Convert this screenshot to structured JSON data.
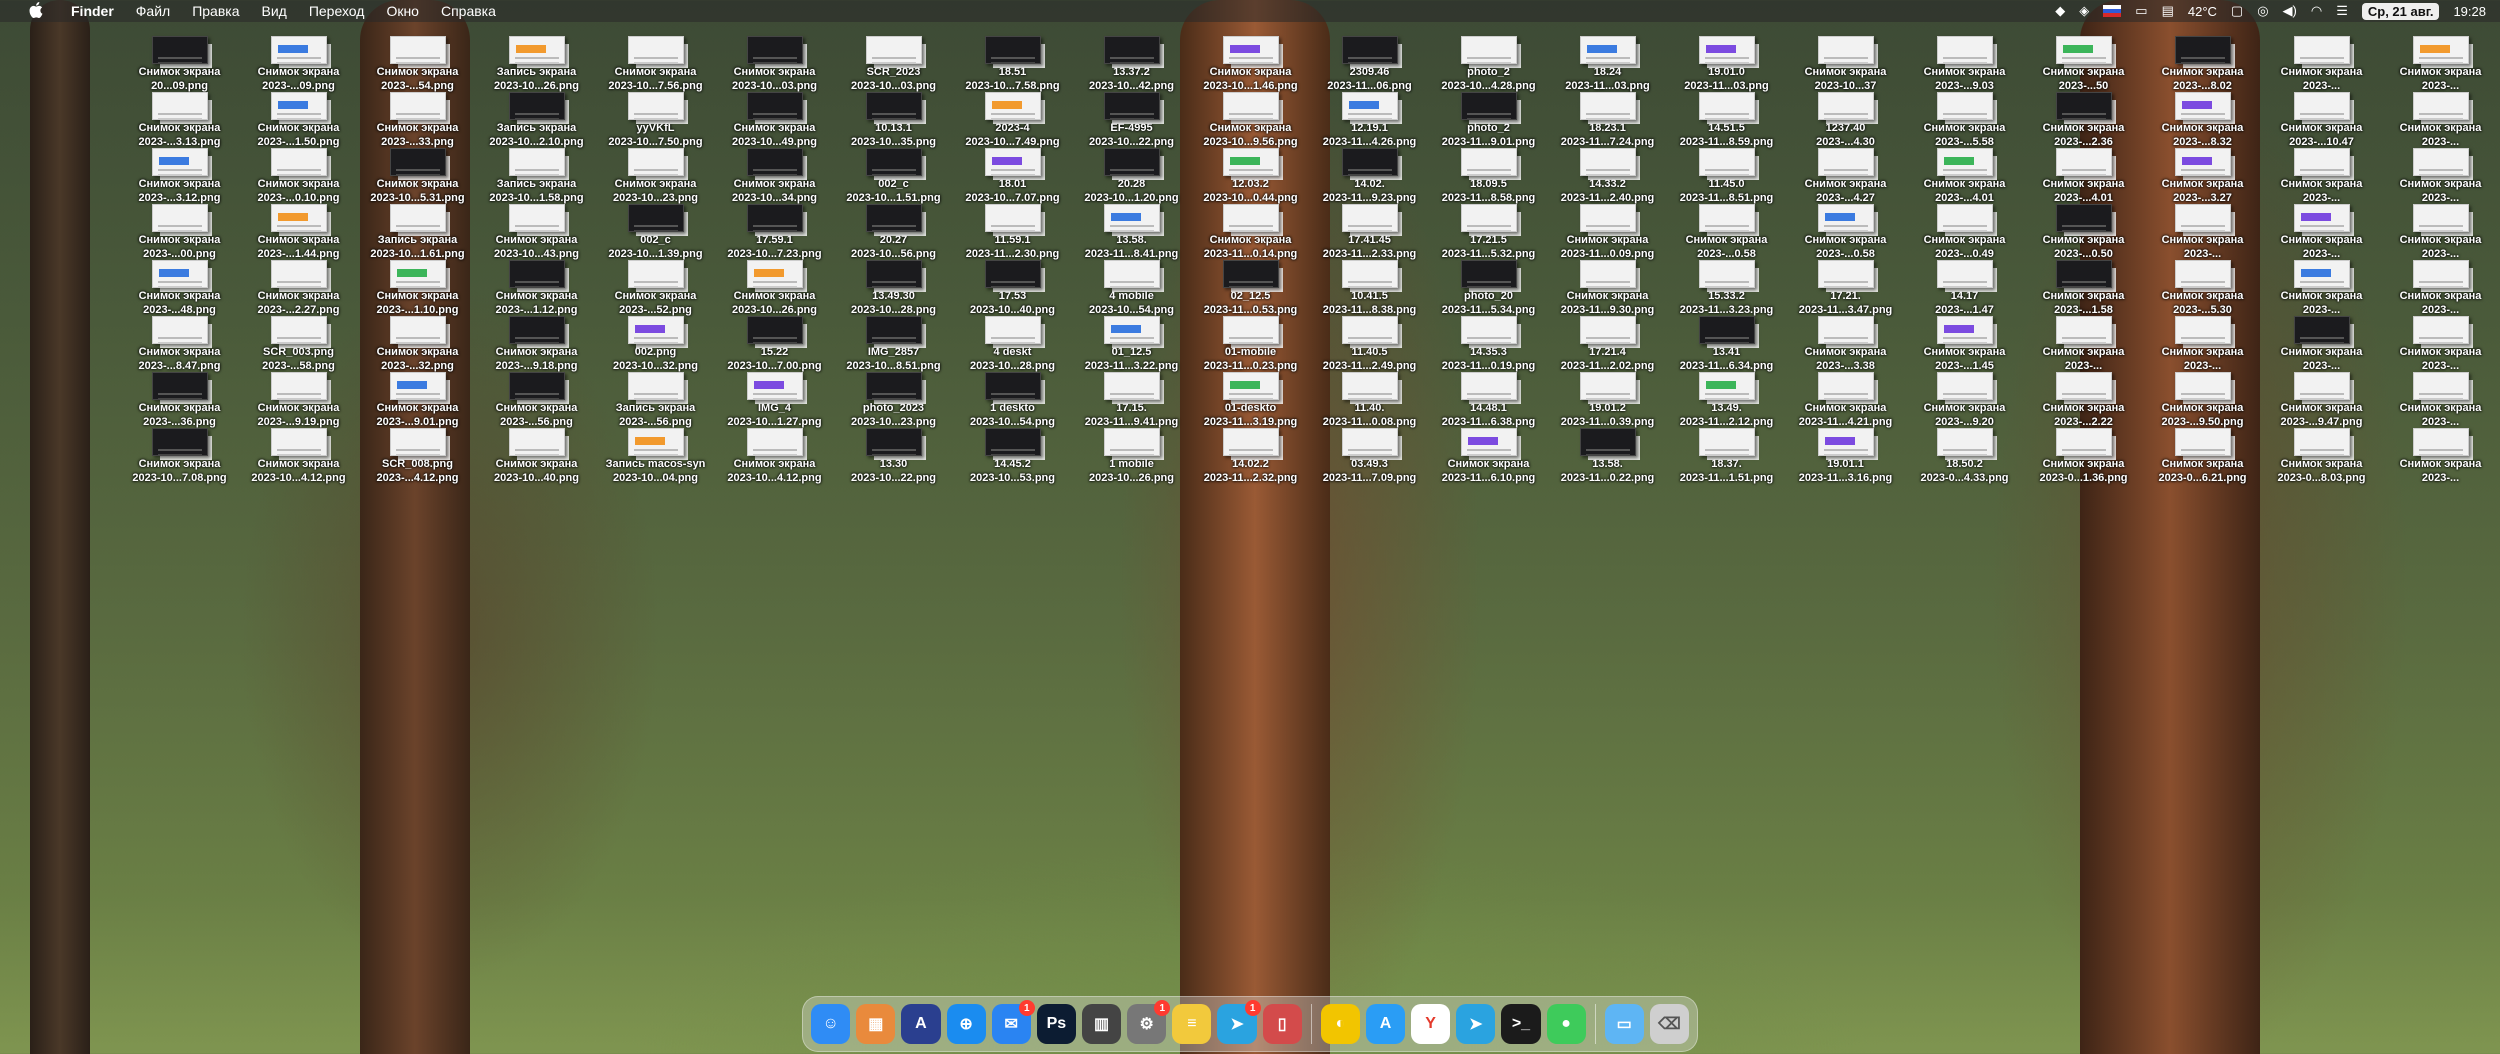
{
  "menubar": {
    "app_name": "Finder",
    "menus": [
      "Файл",
      "Правка",
      "Вид",
      "Переход",
      "Окно",
      "Справка"
    ],
    "temperature": "42°C",
    "date": "Ср, 21 авг.",
    "time": "19:28",
    "status_icons": [
      "dropbox-icon",
      "vpn-icon",
      "flag-ru-icon",
      "battery-icon",
      "temperature-icon",
      "message-icon",
      "screen-icon",
      "volume-icon",
      "wifi-icon"
    ]
  },
  "desktop": {
    "files": [
      {
        "name": "Снимок экрана",
        "sub": "20...09.png",
        "style": "dark"
      },
      {
        "name": "Снимок экрана",
        "sub": "2023-...09.png",
        "style": "blue"
      },
      {
        "name": "Снимок экрана",
        "sub": "2023-...54.png",
        "style": "light"
      },
      {
        "name": "Запись экрана",
        "sub": "2023-10...26.png",
        "style": "orange"
      },
      {
        "name": "Снимок экрана",
        "sub": "2023-10...7.56.png",
        "style": "light"
      },
      {
        "name": "Снимок экрана",
        "sub": "2023-10...03.png",
        "style": "dark"
      },
      {
        "name": "SCR_2023",
        "sub": "2023-10...03.png",
        "style": "light"
      },
      {
        "name": "18.51",
        "sub": "2023-10...7.58.png",
        "style": "dark"
      },
      {
        "name": "13.37.2",
        "sub": "2023-10...42.png",
        "style": "dark"
      },
      {
        "name": "Снимок экрана",
        "sub": "2023-10...1.46.png",
        "style": "purple"
      },
      {
        "name": "2309.46",
        "sub": "2023-11...06.png",
        "style": "dark"
      },
      {
        "name": "photo_2",
        "sub": "2023-10...4.28.png",
        "style": "light"
      },
      {
        "name": "18.24",
        "sub": "2023-11...03.png",
        "style": "blue"
      },
      {
        "name": "19.01.0",
        "sub": "2023-11...03.png",
        "style": "purple"
      },
      {
        "name": "Снимок экрана",
        "sub": "2023-10...37",
        "style": "light"
      },
      {
        "name": "Снимок экрана",
        "sub": "2023-...9.03",
        "style": "light"
      },
      {
        "name": "Снимок экрана",
        "sub": "2023-...50",
        "style": "green"
      },
      {
        "name": "Снимок экрана",
        "sub": "2023-...8.02",
        "style": "dark"
      },
      {
        "name": "Снимок экрана",
        "sub": "2023-...",
        "style": "light"
      },
      {
        "name": "Снимок экрана",
        "sub": "2023-...",
        "style": "orange"
      },
      {
        "name": "Снимок экрана",
        "sub": "2023-...3.13.png",
        "style": "light"
      },
      {
        "name": "Снимок экрана",
        "sub": "2023-...1.50.png",
        "style": "blue"
      },
      {
        "name": "Снимок экрана",
        "sub": "2023-...33.png",
        "style": "light"
      },
      {
        "name": "Запись экрана",
        "sub": "2023-10...2.10.png",
        "style": "dark"
      },
      {
        "name": "yyVKfL",
        "sub": "2023-10...7.50.png",
        "style": "light"
      },
      {
        "name": "Снимок экрана",
        "sub": "2023-10...49.png",
        "style": "dark"
      },
      {
        "name": "10.13.1",
        "sub": "2023-10...35.png",
        "style": "dark"
      },
      {
        "name": "2023-4",
        "sub": "2023-10...7.49.png",
        "style": "orange"
      },
      {
        "name": "EF-4995",
        "sub": "2023-10...22.png",
        "style": "dark"
      },
      {
        "name": "Снимок экрана",
        "sub": "2023-10...9.56.png",
        "style": "light"
      },
      {
        "name": "12.19.1",
        "sub": "2023-11...4.26.png",
        "style": "blue"
      },
      {
        "name": "photo_2",
        "sub": "2023-11...9.01.png",
        "style": "dark"
      },
      {
        "name": "18.23.1",
        "sub": "2023-11...7.24.png",
        "style": "light"
      },
      {
        "name": "14.51.5",
        "sub": "2023-11...8.59.png",
        "style": "light"
      },
      {
        "name": "1237.40",
        "sub": "2023-...4.30",
        "style": "light"
      },
      {
        "name": "Снимок экрана",
        "sub": "2023-...5.58",
        "style": "light"
      },
      {
        "name": "Снимок экрана",
        "sub": "2023-...2.36",
        "style": "dark"
      },
      {
        "name": "Снимок экрана",
        "sub": "2023-...8.32",
        "style": "purple"
      },
      {
        "name": "Снимок экрана",
        "sub": "2023-...10.47",
        "style": "light"
      },
      {
        "name": "Снимок экрана",
        "sub": "2023-...",
        "style": "light"
      },
      {
        "name": "Снимок экрана",
        "sub": "2023-...3.12.png",
        "style": "blue"
      },
      {
        "name": "Снимок экрана",
        "sub": "2023-...0.10.png",
        "style": "light"
      },
      {
        "name": "Снимок экрана",
        "sub": "2023-10...5.31.png",
        "style": "dark"
      },
      {
        "name": "Запись экрана",
        "sub": "2023-10...1.58.png",
        "style": "light"
      },
      {
        "name": "Снимок экрана",
        "sub": "2023-10...23.png",
        "style": "light"
      },
      {
        "name": "Снимок экрана",
        "sub": "2023-10...34.png",
        "style": "dark"
      },
      {
        "name": "002_c",
        "sub": "2023-10...1.51.png",
        "style": "dark"
      },
      {
        "name": "18.01",
        "sub": "2023-10...7.07.png",
        "style": "purple"
      },
      {
        "name": "20.28",
        "sub": "2023-10...1.20.png",
        "style": "dark"
      },
      {
        "name": "12.03.2",
        "sub": "2023-10...0.44.png",
        "style": "green"
      },
      {
        "name": "14.02.",
        "sub": "2023-11...9.23.png",
        "style": "dark"
      },
      {
        "name": "18.09.5",
        "sub": "2023-11...8.58.png",
        "style": "light"
      },
      {
        "name": "14.33.2",
        "sub": "2023-11...2.40.png",
        "style": "light"
      },
      {
        "name": "11.45.0",
        "sub": "2023-11...8.51.png",
        "style": "light"
      },
      {
        "name": "Снимок экрана",
        "sub": "2023-...4.27",
        "style": "light"
      },
      {
        "name": "Снимок экрана",
        "sub": "2023-...4.01",
        "style": "green"
      },
      {
        "name": "Снимок экрана",
        "sub": "2023-...4.01",
        "style": "light"
      },
      {
        "name": "Снимок экрана",
        "sub": "2023-...3.27",
        "style": "purple"
      },
      {
        "name": "Снимок экрана",
        "sub": "2023-...",
        "style": "light"
      },
      {
        "name": "Снимок экрана",
        "sub": "2023-...",
        "style": "light"
      },
      {
        "name": "Снимок экрана",
        "sub": "2023-...00.png",
        "style": "light"
      },
      {
        "name": "Снимок экрана",
        "sub": "2023-...1.44.png",
        "style": "orange"
      },
      {
        "name": "Запись экрана",
        "sub": "2023-10...1.61.png",
        "style": "light"
      },
      {
        "name": "Снимок экрана",
        "sub": "2023-10...43.png",
        "style": "light"
      },
      {
        "name": "002_c",
        "sub": "2023-10...1.39.png",
        "style": "dark"
      },
      {
        "name": "17.59.1",
        "sub": "2023-10...7.23.png",
        "style": "dark"
      },
      {
        "name": "20.27",
        "sub": "2023-10...56.png",
        "style": "dark"
      },
      {
        "name": "11.59.1",
        "sub": "2023-11...2.30.png",
        "style": "light"
      },
      {
        "name": "13.58.",
        "sub": "2023-11...8.41.png",
        "style": "blue"
      },
      {
        "name": "Снимок экрана",
        "sub": "2023-11...0.14.png",
        "style": "light"
      },
      {
        "name": "17.41.45",
        "sub": "2023-11...2.33.png",
        "style": "light"
      },
      {
        "name": "17.21.5",
        "sub": "2023-11...5.32.png",
        "style": "light"
      },
      {
        "name": "Снимок экрана",
        "sub": "2023-11...0.09.png",
        "style": "light"
      },
      {
        "name": "Снимок экрана",
        "sub": "2023-...0.58",
        "style": "light"
      },
      {
        "name": "Снимок экрана",
        "sub": "2023-...0.58",
        "style": "blue"
      },
      {
        "name": "Снимок экрана",
        "sub": "2023-...0.49",
        "style": "light"
      },
      {
        "name": "Снимок экрана",
        "sub": "2023-...0.50",
        "style": "dark"
      },
      {
        "name": "Снимок экрана",
        "sub": "2023-...",
        "style": "light"
      },
      {
        "name": "Снимок экрана",
        "sub": "2023-...",
        "style": "purple"
      },
      {
        "name": "Снимок экрана",
        "sub": "2023-...",
        "style": "light"
      },
      {
        "name": "Снимок экрана",
        "sub": "2023-...48.png",
        "style": "blue"
      },
      {
        "name": "Снимок экрана",
        "sub": "2023-...2.27.png",
        "style": "light"
      },
      {
        "name": "Снимок экрана",
        "sub": "2023-...1.10.png",
        "style": "green"
      },
      {
        "name": "Снимок экрана",
        "sub": "2023-...1.12.png",
        "style": "dark"
      },
      {
        "name": "Снимок экрана",
        "sub": "2023-...52.png",
        "style": "light"
      },
      {
        "name": "Снимок экрана",
        "sub": "2023-10...26.png",
        "style": "orange"
      },
      {
        "name": "13.49.30",
        "sub": "2023-10...28.png",
        "style": "dark"
      },
      {
        "name": "17.53",
        "sub": "2023-10...40.png",
        "style": "dark"
      },
      {
        "name": "4 mobile",
        "sub": "2023-10...54.png",
        "style": "light"
      },
      {
        "name": "02_12.5",
        "sub": "2023-11...0.53.png",
        "style": "dark"
      },
      {
        "name": "10.41.5",
        "sub": "2023-11...8.38.png",
        "style": "light"
      },
      {
        "name": "photo_20",
        "sub": "2023-11...5.34.png",
        "style": "dark"
      },
      {
        "name": "Снимок экрана",
        "sub": "2023-11...9.30.png",
        "style": "light"
      },
      {
        "name": "15.33.2",
        "sub": "2023-11...3.23.png",
        "style": "light"
      },
      {
        "name": "17.21.",
        "sub": "2023-11...3.47.png",
        "style": "light"
      },
      {
        "name": "14.17",
        "sub": "2023-...1.47",
        "style": "light"
      },
      {
        "name": "Снимок экрана",
        "sub": "2023-...1.58",
        "style": "dark"
      },
      {
        "name": "Снимок экрана",
        "sub": "2023-...5.30",
        "style": "light"
      },
      {
        "name": "Снимок экрана",
        "sub": "2023-...",
        "style": "blue"
      },
      {
        "name": "Снимок экрана",
        "sub": "2023-...",
        "style": "light"
      },
      {
        "name": "Снимок экрана",
        "sub": "2023-...8.47.png",
        "style": "light"
      },
      {
        "name": "SCR_003.png",
        "sub": "2023-...58.png",
        "style": "light"
      },
      {
        "name": "Снимок экрана",
        "sub": "2023-...32.png",
        "style": "light"
      },
      {
        "name": "Снимок экрана",
        "sub": "2023-...9.18.png",
        "style": "dark"
      },
      {
        "name": "002.png",
        "sub": "2023-10...32.png",
        "style": "purple"
      },
      {
        "name": "15.22",
        "sub": "2023-10...7.00.png",
        "style": "dark"
      },
      {
        "name": "IMG_2857",
        "sub": "2023-10...8.51.png",
        "style": "dark"
      },
      {
        "name": "4 deskt",
        "sub": "2023-10...28.png",
        "style": "light"
      },
      {
        "name": "01_12.5",
        "sub": "2023-11...3.22.png",
        "style": "blue"
      },
      {
        "name": "01-mobile",
        "sub": "2023-11...0.23.png",
        "style": "light"
      },
      {
        "name": "11.40.5",
        "sub": "2023-11...2.49.png",
        "style": "light"
      },
      {
        "name": "14.35.3",
        "sub": "2023-11...0.19.png",
        "style": "light"
      },
      {
        "name": "17.21.4",
        "sub": "2023-11...2.02.png",
        "style": "light"
      },
      {
        "name": "13.41",
        "sub": "2023-11...6.34.png",
        "style": "dark"
      },
      {
        "name": "Снимок экрана",
        "sub": "2023-...3.38",
        "style": "light"
      },
      {
        "name": "Снимок экрана",
        "sub": "2023-...1.45",
        "style": "purple"
      },
      {
        "name": "Снимок экрана",
        "sub": "2023-...",
        "style": "light"
      },
      {
        "name": "Снимок экрана",
        "sub": "2023-...",
        "style": "light"
      },
      {
        "name": "Снимок экрана",
        "sub": "2023-...",
        "style": "dark"
      },
      {
        "name": "Снимок экрана",
        "sub": "2023-...",
        "style": "light"
      },
      {
        "name": "Снимок экрана",
        "sub": "2023-...36.png",
        "style": "dark"
      },
      {
        "name": "Снимок экрана",
        "sub": "2023-...9.19.png",
        "style": "light"
      },
      {
        "name": "Снимок экрана",
        "sub": "2023-...9.01.png",
        "style": "blue"
      },
      {
        "name": "Снимок экрана",
        "sub": "2023-...56.png",
        "style": "dark"
      },
      {
        "name": "Запись экрана",
        "sub": "2023-...56.png",
        "style": "light"
      },
      {
        "name": "IMG_4",
        "sub": "2023-10...1.27.png",
        "style": "purple"
      },
      {
        "name": "photo_2023",
        "sub": "2023-10...23.png",
        "style": "dark"
      },
      {
        "name": "1 deskto",
        "sub": "2023-10...54.png",
        "style": "dark"
      },
      {
        "name": "17.15.",
        "sub": "2023-11...9.41.png",
        "style": "light"
      },
      {
        "name": "01-deskto",
        "sub": "2023-11...3.19.png",
        "style": "green"
      },
      {
        "name": "11.40.",
        "sub": "2023-11...0.08.png",
        "style": "light"
      },
      {
        "name": "14.48.1",
        "sub": "2023-11...6.38.png",
        "style": "light"
      },
      {
        "name": "19.01.2",
        "sub": "2023-11...0.39.png",
        "style": "light"
      },
      {
        "name": "13.49.",
        "sub": "2023-11...2.12.png",
        "style": "green"
      },
      {
        "name": "Снимок экрана",
        "sub": "2023-11...4.21.png",
        "style": "light"
      },
      {
        "name": "Снимок экрана",
        "sub": "2023-...9.20",
        "style": "light"
      },
      {
        "name": "Снимок экрана",
        "sub": "2023-...2.22",
        "style": "light"
      },
      {
        "name": "Снимок экрана",
        "sub": "2023-...9.50.png",
        "style": "light"
      },
      {
        "name": "Снимок экрана",
        "sub": "2023-...9.47.png",
        "style": "light"
      },
      {
        "name": "Снимок экрана",
        "sub": "2023-...",
        "style": "light"
      },
      {
        "name": "Снимок экрана",
        "sub": "2023-10...7.08.png",
        "style": "dark"
      },
      {
        "name": "Снимок экрана",
        "sub": "2023-10...4.12.png",
        "style": "light"
      },
      {
        "name": "SCR_008.png",
        "sub": "2023-...4.12.png",
        "style": "light"
      },
      {
        "name": "Снимок экрана",
        "sub": "2023-10...40.png",
        "style": "light"
      },
      {
        "name": "Запись macos-syn",
        "sub": "2023-10...04.png",
        "style": "orange"
      },
      {
        "name": "Снимок экрана",
        "sub": "2023-10...4.12.png",
        "style": "light"
      },
      {
        "name": "13.30",
        "sub": "2023-10...22.png",
        "style": "dark"
      },
      {
        "name": "14.45.2",
        "sub": "2023-10...53.png",
        "style": "dark"
      },
      {
        "name": "1 mobile",
        "sub": "2023-10...26.png",
        "style": "light"
      },
      {
        "name": "14.02.2",
        "sub": "2023-11...2.32.png",
        "style": "light"
      },
      {
        "name": "03.49.3",
        "sub": "2023-11...7.09.png",
        "style": "light"
      },
      {
        "name": "Снимок экрана",
        "sub": "2023-11...6.10.png",
        "style": "purple"
      },
      {
        "name": "13.58.",
        "sub": "2023-11...0.22.png",
        "style": "dark"
      },
      {
        "name": "18.37.",
        "sub": "2023-11...1.51.png",
        "style": "light"
      },
      {
        "name": "19.01.1",
        "sub": "2023-11...3.16.png",
        "style": "purple"
      },
      {
        "name": "18.50.2",
        "sub": "2023-0...4.33.png",
        "style": "light"
      },
      {
        "name": "Снимок экрана",
        "sub": "2023-0...1.36.png",
        "style": "light"
      },
      {
        "name": "Снимок экрана",
        "sub": "2023-0...6.21.png",
        "style": "light"
      },
      {
        "name": "Снимок экрана",
        "sub": "2023-0...8.03.png",
        "style": "light"
      },
      {
        "name": "Снимок экрана",
        "sub": "2023-...",
        "style": "light"
      }
    ]
  },
  "dock": {
    "items": [
      {
        "name": "finder-icon",
        "glyph": "☺",
        "color": "#2f8cf5"
      },
      {
        "name": "launchpad-icon",
        "glyph": "▦",
        "color": "#e98a3c"
      },
      {
        "name": "affinity-designer-icon",
        "glyph": "A",
        "color": "#2a3f8f"
      },
      {
        "name": "safari-icon",
        "glyph": "⊕",
        "color": "#1a8cf0"
      },
      {
        "name": "mail-icon",
        "glyph": "✉",
        "color": "#2a84f2",
        "badge": "1"
      },
      {
        "name": "photoshop-icon",
        "glyph": "Ps",
        "color": "#0c1c32"
      },
      {
        "name": "calculator-icon",
        "glyph": "▥",
        "color": "#444"
      },
      {
        "name": "system-settings-icon",
        "glyph": "⚙",
        "color": "#777",
        "badge": "1"
      },
      {
        "name": "notes-icon",
        "glyph": "≡",
        "color": "#f2c93c"
      },
      {
        "name": "telegram-icon",
        "glyph": "➤",
        "color": "#2aa3e0",
        "badge": "1"
      },
      {
        "name": "iphone-mirroring-icon",
        "glyph": "▯",
        "color": "#d34b4b"
      },
      {
        "name": "sep"
      },
      {
        "name": "screen-studio-icon",
        "glyph": "◐",
        "color": "#f2c500"
      },
      {
        "name": "app-store-icon",
        "glyph": "A",
        "color": "#2a9df5"
      },
      {
        "name": "yandex-browser-icon",
        "glyph": "Y",
        "color": "#ffffff",
        "text": "#e43a2c"
      },
      {
        "name": "telegram-alt-icon",
        "glyph": "➤",
        "color": "#2aa3e0"
      },
      {
        "name": "terminal-icon",
        "glyph": ">_",
        "color": "#1b1b1b"
      },
      {
        "name": "messages-icon",
        "glyph": "●",
        "color": "#3ecb5b"
      },
      {
        "name": "sep"
      },
      {
        "name": "downloads-folder-icon",
        "glyph": "▭",
        "color": "#5eb5f4"
      },
      {
        "name": "trash-icon",
        "glyph": "⌫",
        "color": "#cfcfcf",
        "text": "#555"
      }
    ]
  }
}
